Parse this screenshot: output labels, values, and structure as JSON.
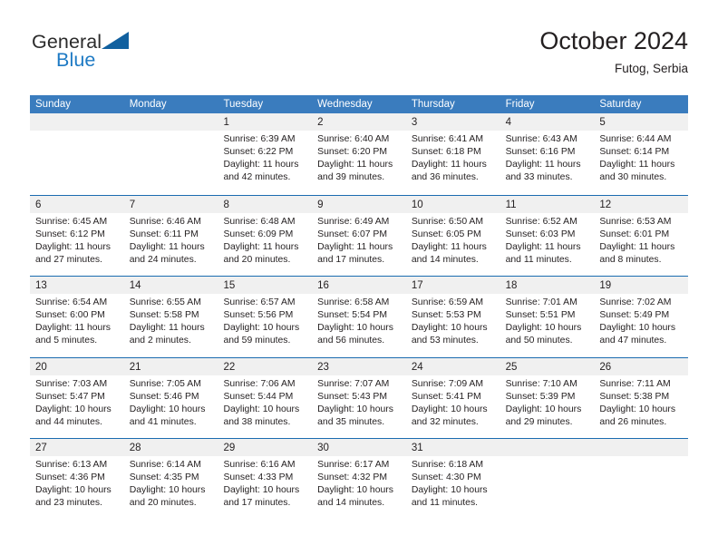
{
  "brand": {
    "name_top": "General",
    "name_bottom": "Blue",
    "accent_color": "#1e7ac4",
    "triangle_color": "#11609f",
    "triangle_icon": "triangle-icon"
  },
  "header": {
    "title": "October 2024",
    "subtitle": "Futog, Serbia"
  },
  "calendar": {
    "header_bg": "#3a7cbe",
    "row_divider_color": "#1b6cb0",
    "daynum_band_bg": "#f0f0f0",
    "day_names": [
      "Sunday",
      "Monday",
      "Tuesday",
      "Wednesday",
      "Thursday",
      "Friday",
      "Saturday"
    ],
    "weeks": [
      [
        {
          "empty": true
        },
        {
          "empty": true
        },
        {
          "day": "1",
          "sunrise": "Sunrise: 6:39 AM",
          "sunset": "Sunset: 6:22 PM",
          "daylight": "Daylight: 11 hours and 42 minutes."
        },
        {
          "day": "2",
          "sunrise": "Sunrise: 6:40 AM",
          "sunset": "Sunset: 6:20 PM",
          "daylight": "Daylight: 11 hours and 39 minutes."
        },
        {
          "day": "3",
          "sunrise": "Sunrise: 6:41 AM",
          "sunset": "Sunset: 6:18 PM",
          "daylight": "Daylight: 11 hours and 36 minutes."
        },
        {
          "day": "4",
          "sunrise": "Sunrise: 6:43 AM",
          "sunset": "Sunset: 6:16 PM",
          "daylight": "Daylight: 11 hours and 33 minutes."
        },
        {
          "day": "5",
          "sunrise": "Sunrise: 6:44 AM",
          "sunset": "Sunset: 6:14 PM",
          "daylight": "Daylight: 11 hours and 30 minutes."
        }
      ],
      [
        {
          "day": "6",
          "sunrise": "Sunrise: 6:45 AM",
          "sunset": "Sunset: 6:12 PM",
          "daylight": "Daylight: 11 hours and 27 minutes."
        },
        {
          "day": "7",
          "sunrise": "Sunrise: 6:46 AM",
          "sunset": "Sunset: 6:11 PM",
          "daylight": "Daylight: 11 hours and 24 minutes."
        },
        {
          "day": "8",
          "sunrise": "Sunrise: 6:48 AM",
          "sunset": "Sunset: 6:09 PM",
          "daylight": "Daylight: 11 hours and 20 minutes."
        },
        {
          "day": "9",
          "sunrise": "Sunrise: 6:49 AM",
          "sunset": "Sunset: 6:07 PM",
          "daylight": "Daylight: 11 hours and 17 minutes."
        },
        {
          "day": "10",
          "sunrise": "Sunrise: 6:50 AM",
          "sunset": "Sunset: 6:05 PM",
          "daylight": "Daylight: 11 hours and 14 minutes."
        },
        {
          "day": "11",
          "sunrise": "Sunrise: 6:52 AM",
          "sunset": "Sunset: 6:03 PM",
          "daylight": "Daylight: 11 hours and 11 minutes."
        },
        {
          "day": "12",
          "sunrise": "Sunrise: 6:53 AM",
          "sunset": "Sunset: 6:01 PM",
          "daylight": "Daylight: 11 hours and 8 minutes."
        }
      ],
      [
        {
          "day": "13",
          "sunrise": "Sunrise: 6:54 AM",
          "sunset": "Sunset: 6:00 PM",
          "daylight": "Daylight: 11 hours and 5 minutes."
        },
        {
          "day": "14",
          "sunrise": "Sunrise: 6:55 AM",
          "sunset": "Sunset: 5:58 PM",
          "daylight": "Daylight: 11 hours and 2 minutes."
        },
        {
          "day": "15",
          "sunrise": "Sunrise: 6:57 AM",
          "sunset": "Sunset: 5:56 PM",
          "daylight": "Daylight: 10 hours and 59 minutes."
        },
        {
          "day": "16",
          "sunrise": "Sunrise: 6:58 AM",
          "sunset": "Sunset: 5:54 PM",
          "daylight": "Daylight: 10 hours and 56 minutes."
        },
        {
          "day": "17",
          "sunrise": "Sunrise: 6:59 AM",
          "sunset": "Sunset: 5:53 PM",
          "daylight": "Daylight: 10 hours and 53 minutes."
        },
        {
          "day": "18",
          "sunrise": "Sunrise: 7:01 AM",
          "sunset": "Sunset: 5:51 PM",
          "daylight": "Daylight: 10 hours and 50 minutes."
        },
        {
          "day": "19",
          "sunrise": "Sunrise: 7:02 AM",
          "sunset": "Sunset: 5:49 PM",
          "daylight": "Daylight: 10 hours and 47 minutes."
        }
      ],
      [
        {
          "day": "20",
          "sunrise": "Sunrise: 7:03 AM",
          "sunset": "Sunset: 5:47 PM",
          "daylight": "Daylight: 10 hours and 44 minutes."
        },
        {
          "day": "21",
          "sunrise": "Sunrise: 7:05 AM",
          "sunset": "Sunset: 5:46 PM",
          "daylight": "Daylight: 10 hours and 41 minutes."
        },
        {
          "day": "22",
          "sunrise": "Sunrise: 7:06 AM",
          "sunset": "Sunset: 5:44 PM",
          "daylight": "Daylight: 10 hours and 38 minutes."
        },
        {
          "day": "23",
          "sunrise": "Sunrise: 7:07 AM",
          "sunset": "Sunset: 5:43 PM",
          "daylight": "Daylight: 10 hours and 35 minutes."
        },
        {
          "day": "24",
          "sunrise": "Sunrise: 7:09 AM",
          "sunset": "Sunset: 5:41 PM",
          "daylight": "Daylight: 10 hours and 32 minutes."
        },
        {
          "day": "25",
          "sunrise": "Sunrise: 7:10 AM",
          "sunset": "Sunset: 5:39 PM",
          "daylight": "Daylight: 10 hours and 29 minutes."
        },
        {
          "day": "26",
          "sunrise": "Sunrise: 7:11 AM",
          "sunset": "Sunset: 5:38 PM",
          "daylight": "Daylight: 10 hours and 26 minutes."
        }
      ],
      [
        {
          "day": "27",
          "sunrise": "Sunrise: 6:13 AM",
          "sunset": "Sunset: 4:36 PM",
          "daylight": "Daylight: 10 hours and 23 minutes."
        },
        {
          "day": "28",
          "sunrise": "Sunrise: 6:14 AM",
          "sunset": "Sunset: 4:35 PM",
          "daylight": "Daylight: 10 hours and 20 minutes."
        },
        {
          "day": "29",
          "sunrise": "Sunrise: 6:16 AM",
          "sunset": "Sunset: 4:33 PM",
          "daylight": "Daylight: 10 hours and 17 minutes."
        },
        {
          "day": "30",
          "sunrise": "Sunrise: 6:17 AM",
          "sunset": "Sunset: 4:32 PM",
          "daylight": "Daylight: 10 hours and 14 minutes."
        },
        {
          "day": "31",
          "sunrise": "Sunrise: 6:18 AM",
          "sunset": "Sunset: 4:30 PM",
          "daylight": "Daylight: 10 hours and 11 minutes."
        },
        {
          "empty": true
        },
        {
          "empty": true
        }
      ]
    ]
  }
}
